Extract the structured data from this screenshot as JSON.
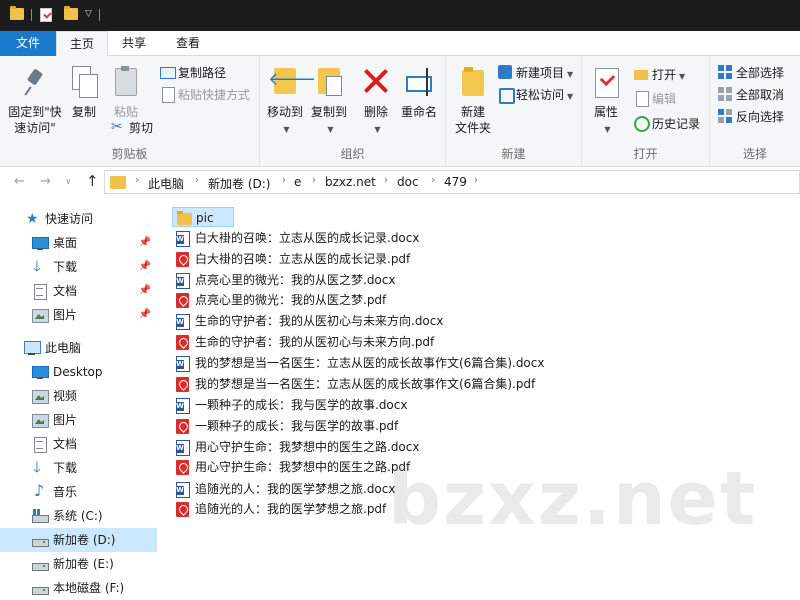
{
  "ribbon_tabs": {
    "file": "文件",
    "home": "主页",
    "share": "共享",
    "view": "查看"
  },
  "clipboard": {
    "pin_line1": "固定到\"快",
    "pin_line2": "速访问\"",
    "copy": "复制",
    "paste": "粘贴",
    "copy_path": "复制路径",
    "paste_shortcut": "粘贴快捷方式",
    "cut": "剪切",
    "group_label": "剪贴板"
  },
  "organize": {
    "move_to": "移动到",
    "copy_to": "复制到",
    "delete": "删除",
    "rename": "重命名",
    "group_label": "组织"
  },
  "new_group": {
    "new_folder_line1": "新建",
    "new_folder_line2": "文件夹",
    "new_item": "新建项目",
    "easy_access": "轻松访问",
    "group_label": "新建"
  },
  "open_group": {
    "properties": "属性",
    "open": "打开",
    "edit": "编辑",
    "history": "历史记录",
    "group_label": "打开"
  },
  "select_group": {
    "select_all": "全部选择",
    "select_none": "全部取消",
    "invert": "反向选择",
    "group_label": "选择"
  },
  "breadcrumb": [
    "此电脑",
    "新加卷 (D:)",
    "e",
    "bzxz.net",
    "doc",
    "479"
  ],
  "nav": {
    "quick_access": "快速访问",
    "desktop": "桌面",
    "downloads": "下载",
    "documents": "文档",
    "pictures": "图片",
    "this_pc": "此电脑",
    "pc_desktop": "Desktop",
    "videos": "视频",
    "pc_pictures": "图片",
    "pc_documents": "文档",
    "pc_downloads": "下载",
    "music": "音乐",
    "drive_c": "系统 (C:)",
    "drive_d": "新加卷 (D:)",
    "drive_e": "新加卷 (E:)",
    "drive_f": "本地磁盘 (F:)"
  },
  "files": [
    {
      "name": "pic",
      "type": "folder"
    },
    {
      "name": "白大褂的召唤：立志从医的成长记录.docx",
      "type": "docx"
    },
    {
      "name": "白大褂的召唤：立志从医的成长记录.pdf",
      "type": "pdf"
    },
    {
      "name": "点亮心里的微光：我的从医之梦.docx",
      "type": "docx"
    },
    {
      "name": "点亮心里的微光：我的从医之梦.pdf",
      "type": "pdf"
    },
    {
      "name": "生命的守护者：我的从医初心与未来方向.docx",
      "type": "docx"
    },
    {
      "name": "生命的守护者：我的从医初心与未来方向.pdf",
      "type": "pdf"
    },
    {
      "name": "我的梦想是当一名医生：立志从医的成长故事作文(6篇合集).docx",
      "type": "docx"
    },
    {
      "name": "我的梦想是当一名医生：立志从医的成长故事作文(6篇合集).pdf",
      "type": "pdf"
    },
    {
      "name": "一颗种子的成长：我与医学的故事.docx",
      "type": "docx"
    },
    {
      "name": "一颗种子的成长：我与医学的故事.pdf",
      "type": "pdf"
    },
    {
      "name": "用心守护生命：我梦想中的医生之路.docx",
      "type": "docx"
    },
    {
      "name": "用心守护生命：我梦想中的医生之路.pdf",
      "type": "pdf"
    },
    {
      "name": "追随光的人：我的医学梦想之旅.docx",
      "type": "docx"
    },
    {
      "name": "追随光的人：我的医学梦想之旅.pdf",
      "type": "pdf"
    }
  ],
  "watermark": "bzxz.net",
  "colors": {
    "accent": "#1979ca",
    "selection": "#cce8ff",
    "folder": "#f0c24a",
    "pdf": "#d32f2f",
    "docx": "#2b5797"
  }
}
